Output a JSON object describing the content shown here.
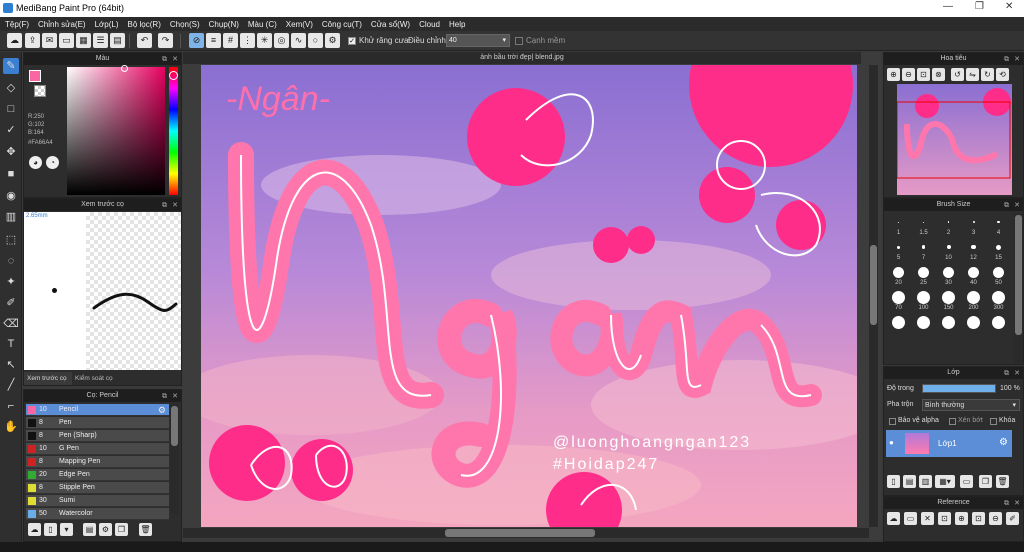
{
  "window": {
    "title": "MediBang Paint Pro (64bit)"
  },
  "menu": [
    "Tệp(F)",
    "Chỉnh sửa(E)",
    "Lớp(L)",
    "Bộ lọc(R)",
    "Chọn(S)",
    "Chụp(N)",
    "Màu (C)",
    "Xem(V)",
    "Công cụ(T)",
    "Cửa sổ(W)",
    "Cloud",
    "Help"
  ],
  "toolbar": {
    "antialias_label": "Khử răng cưa",
    "adjust_label": "Điều chỉnh",
    "adjust_value": "40",
    "snap_label": "Cạnh mềm"
  },
  "color_panel": {
    "title": "Màu",
    "r": "R:250",
    "g": "G:102",
    "b": "B:164",
    "hex": "#FA66A4",
    "fg_color": "#fa66a4"
  },
  "brush_preview": {
    "title": "Xem trước cọ",
    "size": "2.65mm",
    "tab1": "Xem trước cọ",
    "tab2": "Kiểm soát cọ"
  },
  "brush_list": {
    "title": "Cọ: Pencil",
    "items": [
      {
        "size": "10",
        "name": "Pencil",
        "color": "#fa66a4"
      },
      {
        "size": "8",
        "name": "Pen",
        "color": "#111111"
      },
      {
        "size": "8",
        "name": "Pen (Sharp)",
        "color": "#111111"
      },
      {
        "size": "10",
        "name": "G Pen",
        "color": "#cc2222"
      },
      {
        "size": "8",
        "name": "Mapping Pen",
        "color": "#cc2222"
      },
      {
        "size": "20",
        "name": "Edge Pen",
        "color": "#33aa33"
      },
      {
        "size": "8",
        "name": "Stipple Pen",
        "color": "#dddd33"
      },
      {
        "size": "30",
        "name": "Sumi",
        "color": "#dddd33"
      },
      {
        "size": "50",
        "name": "Watercolor",
        "color": "#6aaee8"
      }
    ]
  },
  "document": {
    "tab": "ảnh bầu trời đẹp| blend.jpg"
  },
  "canvas": {
    "handle": "@luonghoangngan123",
    "hashtag": "#Hoidap247",
    "small_word": "-Ngân-"
  },
  "navigator": {
    "title": "Hoa tiêu"
  },
  "brush_size": {
    "title": "Brush Size",
    "labels": [
      "1",
      "1.5",
      "2",
      "3",
      "4",
      "5",
      "7",
      "10",
      "12",
      "15",
      "20",
      "25",
      "30",
      "40",
      "50",
      "70",
      "100",
      "150",
      "200",
      "300",
      "",
      "",
      "",
      "",
      ""
    ]
  },
  "layer": {
    "title": "Lớp",
    "opacity_label": "Độ trong",
    "opacity_value": "100 %",
    "blend_label": "Pha trộn",
    "blend_value": "Bình thường",
    "protect_alpha": "Bảo vệ alpha",
    "clipping": "Xén bớt",
    "lock": "Khóa",
    "layer_name": "Lớp1"
  },
  "reference": {
    "title": "Reference"
  }
}
